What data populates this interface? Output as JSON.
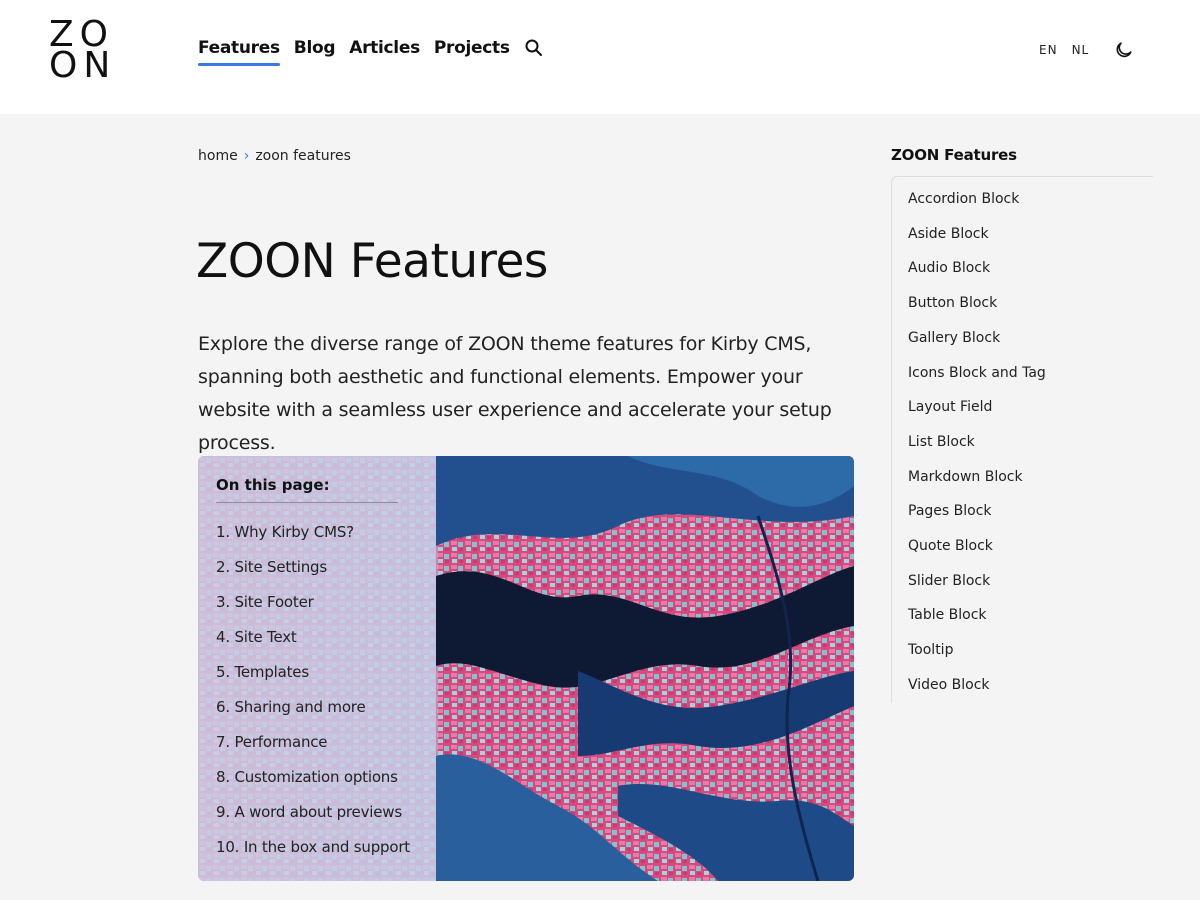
{
  "header": {
    "logo_top": "ZO",
    "logo_bottom": "ON",
    "nav": [
      "Features",
      "Blog",
      "Articles",
      "Projects"
    ],
    "languages": [
      "EN",
      "NL"
    ]
  },
  "breadcrumb": {
    "home": "home",
    "separator": "›",
    "current": "zoon features"
  },
  "page": {
    "title": "ZOON Features",
    "intro": "Explore the diverse range of ZOON theme features for Kirby CMS, spanning both aesthetic and functional elements. Empower your website with a seamless user experience and accelerate your setup process."
  },
  "toc": {
    "title": "On this page:",
    "items": [
      "1. Why Kirby CMS?",
      "2. Site Settings",
      "3. Site Footer",
      "4. Site Text",
      "5. Templates",
      "6. Sharing and more",
      "7. Performance",
      "8. Customization options",
      "9. A word about previews",
      "10. In the box and support"
    ]
  },
  "aside": {
    "title": "ZOON Features",
    "items": [
      "Accordion Block",
      "Aside Block",
      "Audio Block",
      "Button Block",
      "Gallery Block",
      "Icons Block and Tag",
      "Layout Field",
      "List Block",
      "Markdown Block",
      "Pages Block",
      "Quote Block",
      "Slider Block",
      "Table Block",
      "Tooltip",
      "Video Block"
    ]
  },
  "colors": {
    "accent": "#3b78e7",
    "background": "#f4f4f5",
    "water": "#1b3f78",
    "land": "#e0457c"
  },
  "icons": [
    "search-icon",
    "moon-icon"
  ]
}
